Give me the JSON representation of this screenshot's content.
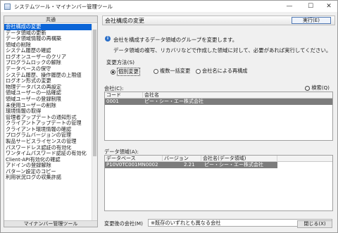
{
  "window": {
    "title": "システムツール・マイナンバー管理ツール",
    "minimize": "—",
    "maximize": "☐",
    "close": "✕"
  },
  "sidebar": {
    "header": "共通",
    "footer": "マイナンバー管理ツール",
    "selected_index": 0,
    "items": [
      "会社構成の変更",
      "データ領域の更新",
      "データ領域情報の再構築",
      "領域の削除",
      "システム履歴の確認",
      "ログオンユーザーのクリア",
      "プログラムロックの解除",
      "データベースの保守",
      "システム履歴、操作履歴の上限値",
      "ログオン形式の変更",
      "物理データパスの再設定",
      "領域ユーザーの一括確認",
      "領域ユーザーの登録制限",
      "未使用ユーザーの削除",
      "環境情報の取得",
      "管理者アップデートの通知形式",
      "クライアントアップデートの管理",
      "クライアント環境情報の確認",
      "プログラムバージョンの管理",
      "製品サービスライセンスの管理",
      "パスワードレス認証の有効化",
      "ワンタイムパスワード認証の有効化",
      "Client-API有効化の確認",
      "アドインの登録解除",
      "パターン設定のコピー",
      "利用状況ログの収集許諾"
    ]
  },
  "content": {
    "title": "会社構成の変更",
    "run_button": "実行(E)",
    "info_line1": "会社を構成するデータ領域のグループを変更します。",
    "info_line2": "データ領域の複写、リカバリなどで作成した領域に対して、必要があれば実行してください。",
    "method_label": "変更方法(S)",
    "radios": [
      {
        "label": "個別変更",
        "checked": true
      },
      {
        "label": "複数一括変更",
        "checked": false
      },
      {
        "label": "会社名による再構成",
        "checked": false
      }
    ],
    "company_label": "会社(C):",
    "search_label": "検索(Q)",
    "company_columns": [
      "コード",
      "会社名"
    ],
    "company_rows": [
      {
        "code": "0001",
        "name": "ピー・シー・エー株式会社"
      }
    ],
    "data_label": "データ領域(A):",
    "data_columns": [
      "データベース",
      "バージョン",
      "会社名(データ領域)"
    ],
    "data_rows": [
      {
        "db": "P10V0TC001MN0002",
        "version": "2.21",
        "company": "ピー・シー・エー株式会社"
      }
    ],
    "change_label": "変更後の会社(M)",
    "change_value": "※既存のいずれとも異なる会社",
    "close_button": "閉じる(X)"
  }
}
